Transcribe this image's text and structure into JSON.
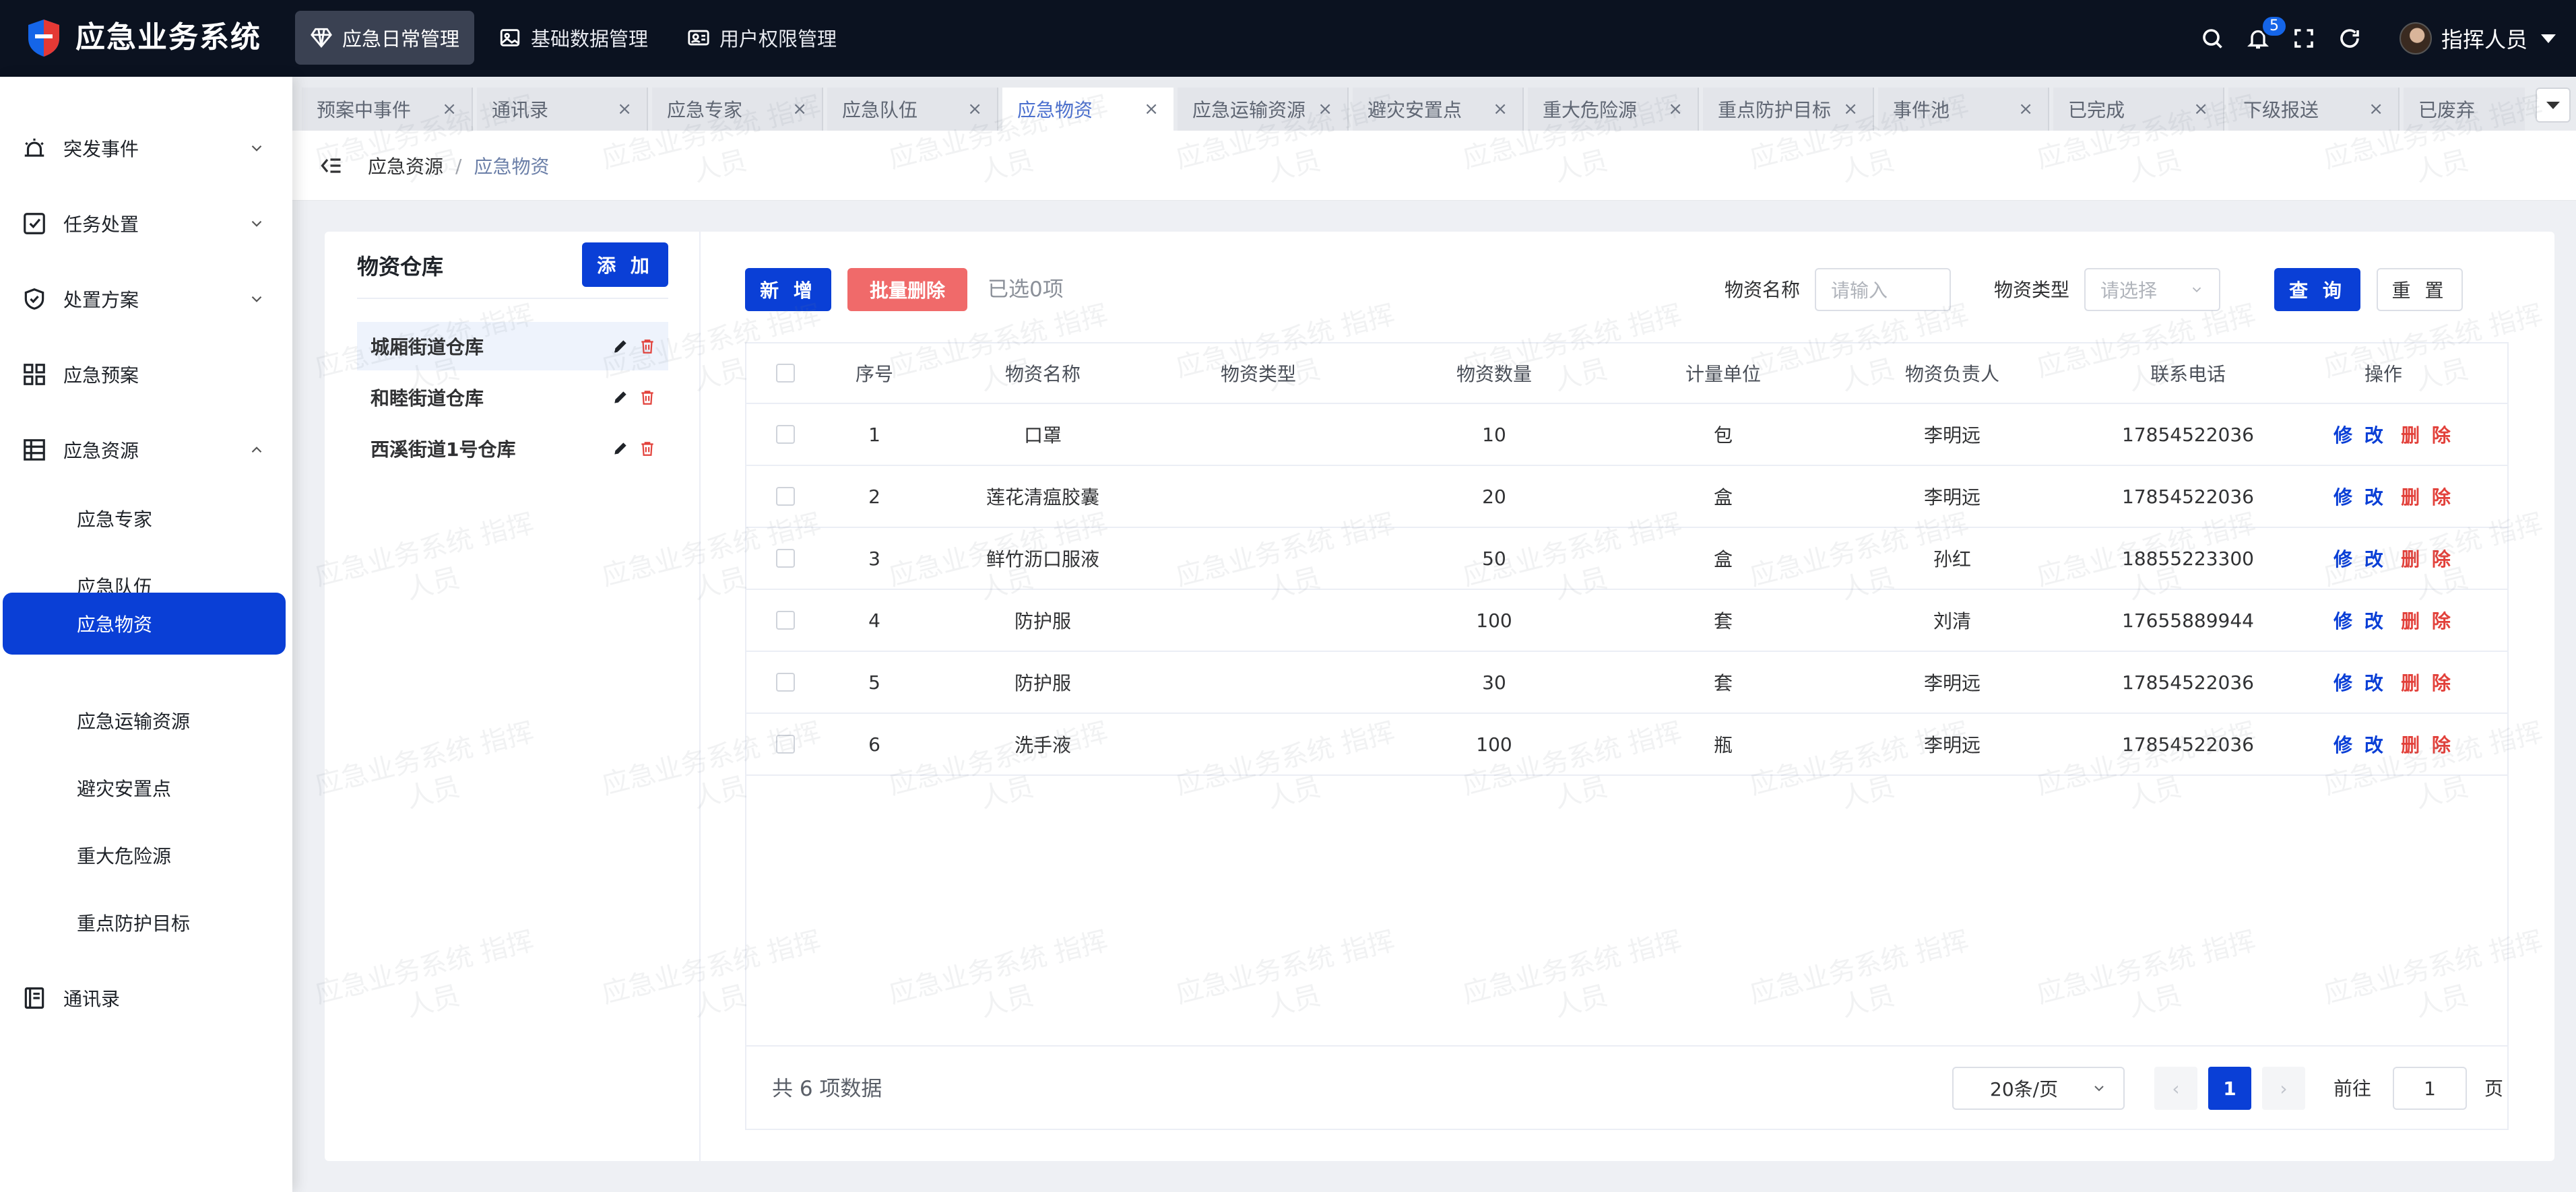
{
  "app": {
    "title": "应急业务系统"
  },
  "topnav": [
    {
      "label": "应急日常管理",
      "icon": "diamond-icon",
      "active": true
    },
    {
      "label": "基础数据管理",
      "icon": "image-icon",
      "active": false
    },
    {
      "label": "用户权限管理",
      "icon": "id-card-icon",
      "active": false
    }
  ],
  "header": {
    "notifications": "5",
    "user": "指挥人员"
  },
  "sidebar": {
    "items": [
      {
        "label": "突发事件"
      },
      {
        "label": "任务处置"
      },
      {
        "label": "处置方案"
      },
      {
        "label": "应急预案"
      },
      {
        "label": "应急资源"
      },
      {
        "label": "通讯录"
      }
    ],
    "sub_items": [
      {
        "label": "应急专家"
      },
      {
        "label": "应急队伍"
      },
      {
        "label": "应急物资"
      },
      {
        "label": "应急运输资源"
      },
      {
        "label": "避灾安置点"
      },
      {
        "label": "重大危险源"
      },
      {
        "label": "重点防护目标"
      }
    ]
  },
  "tabs": [
    {
      "label": "预案中事件",
      "close": "×"
    },
    {
      "label": "通讯录",
      "close": "×"
    },
    {
      "label": "应急专家",
      "close": "×"
    },
    {
      "label": "应急队伍",
      "close": "×"
    },
    {
      "label": "应急物资",
      "close": "×"
    },
    {
      "label": "应急运输资源",
      "close": "×"
    },
    {
      "label": "避灾安置点",
      "close": "×"
    },
    {
      "label": "重大危险源",
      "close": "×"
    },
    {
      "label": "重点防护目标",
      "close": "×"
    },
    {
      "label": "事件池",
      "close": "×"
    },
    {
      "label": "已完成",
      "close": "×"
    },
    {
      "label": "下级报送",
      "close": "×"
    },
    {
      "label": "已废弃",
      "close": ""
    }
  ],
  "breadcrumb": {
    "parent": "应急资源",
    "sep": "/",
    "current": "应急物资"
  },
  "warehouse": {
    "title": "物资仓库",
    "add_label": "添 加",
    "items": [
      {
        "label": "城厢街道仓库"
      },
      {
        "label": "和睦街道仓库"
      },
      {
        "label": "西溪街道1号仓库"
      }
    ]
  },
  "toolbar": {
    "new_label": "新 增",
    "batch_delete_label": "批量删除",
    "selected_text": "已选0项",
    "name_label": "物资名称",
    "name_placeholder": "请输入",
    "type_label": "物资类型",
    "type_placeholder": "请选择",
    "query_label": "查 询",
    "reset_label": "重 置"
  },
  "table": {
    "columns": [
      "序号",
      "物资名称",
      "物资类型",
      "物资数量",
      "计量单位",
      "物资负责人",
      "联系电话",
      "操作"
    ],
    "rows": [
      {
        "no": "1",
        "name": "口罩",
        "type": "",
        "qty": "10",
        "unit": "包",
        "owner": "李明远",
        "phone": "17854522036"
      },
      {
        "no": "2",
        "name": "莲花清瘟胶囊",
        "type": "",
        "qty": "20",
        "unit": "盒",
        "owner": "李明远",
        "phone": "17854522036"
      },
      {
        "no": "3",
        "name": "鲜竹沥口服液",
        "type": "",
        "qty": "50",
        "unit": "盒",
        "owner": "孙红",
        "phone": "18855223300"
      },
      {
        "no": "4",
        "name": "防护服",
        "type": "",
        "qty": "100",
        "unit": "套",
        "owner": "刘清",
        "phone": "17655889944"
      },
      {
        "no": "5",
        "name": "防护服",
        "type": "",
        "qty": "30",
        "unit": "套",
        "owner": "李明远",
        "phone": "17854522036"
      },
      {
        "no": "6",
        "name": "洗手液",
        "type": "",
        "qty": "100",
        "unit": "瓶",
        "owner": "李明远",
        "phone": "17854522036"
      }
    ],
    "edit_label": "修 改",
    "delete_label": "删 除"
  },
  "pagination": {
    "total_text": "共 6 项数据",
    "page_size": "20条/页",
    "prev": "‹",
    "current": "1",
    "next": "›",
    "goto_label": "前往",
    "goto_value": "1",
    "goto_suffix": "页"
  },
  "watermark": {
    "line1": "应急业务系统 指挥",
    "line2": "人员"
  },
  "colors": {
    "primary": "#0a3fd6",
    "danger": "#f06a6a",
    "topbar": "#0b1220"
  }
}
